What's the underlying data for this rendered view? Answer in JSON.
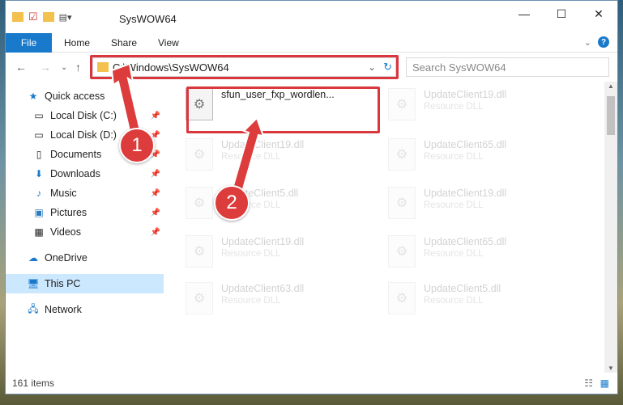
{
  "window": {
    "title": "SysWOW64"
  },
  "ribbon": {
    "tabs": [
      "File",
      "Home",
      "Share",
      "View"
    ]
  },
  "address": {
    "path": "C:\\Windows\\SysWOW64"
  },
  "search": {
    "placeholder": "Search SysWOW64"
  },
  "sidebar": {
    "items": [
      {
        "label": "Quick access"
      },
      {
        "label": "Local Disk (C:)"
      },
      {
        "label": "Local Disk (D:)"
      },
      {
        "label": "Documents"
      },
      {
        "label": "Downloads"
      },
      {
        "label": "Music"
      },
      {
        "label": "Pictures"
      },
      {
        "label": "Videos"
      },
      {
        "label": "OneDrive"
      },
      {
        "label": "This PC"
      },
      {
        "label": "Network"
      }
    ]
  },
  "files": [
    {
      "name": "sfun_user_fxp_wordlen...",
      "sub": ""
    },
    {
      "name": "UpdateClient19.dll",
      "sub": "Resource DLL"
    },
    {
      "name": "UpdateClient19.dll",
      "sub": "Resource DLL"
    },
    {
      "name": "UpdateClient65.dll",
      "sub": "Resource DLL"
    },
    {
      "name": "UpdateClient5.dll",
      "sub": "Resource DLL"
    },
    {
      "name": "UpdateClient19.dll",
      "sub": "Resource DLL"
    },
    {
      "name": "UpdateClient19.dll",
      "sub": "Resource DLL"
    },
    {
      "name": "UpdateClient65.dll",
      "sub": "Resource DLL"
    },
    {
      "name": "UpdateClient63.dll",
      "sub": "Resource DLL"
    },
    {
      "name": "UpdateClient5.dll",
      "sub": "Resource DLL"
    }
  ],
  "status": {
    "count": "161 items"
  },
  "callouts": {
    "one": "1",
    "two": "2"
  },
  "colors": {
    "accent": "#1979ca",
    "highlight": "#d9363e",
    "selection": "#cce8ff"
  }
}
